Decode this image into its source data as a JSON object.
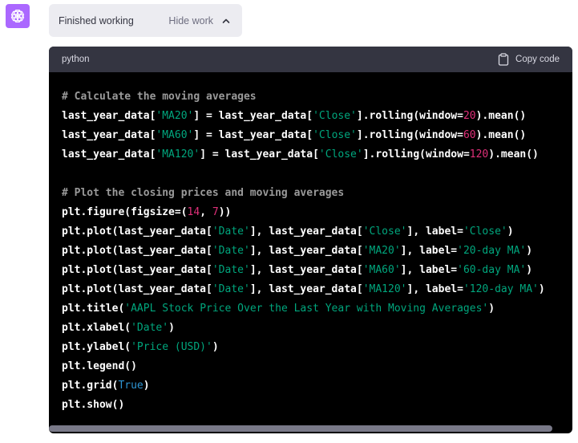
{
  "status": {
    "text": "Finished working",
    "toggle_label": "Hide work"
  },
  "code_block": {
    "language": "python",
    "copy_label": "Copy code",
    "tokens": {
      "c1": "# Calculate the moving averages",
      "l2a": "last_year_data[",
      "l2s1": "'MA20'",
      "l2b": "] = last_year_data[",
      "l2s2": "'Close'",
      "l2c": "].rolling(window=",
      "l2n": "20",
      "l2d": ").mean()",
      "l3a": "last_year_data[",
      "l3s1": "'MA60'",
      "l3b": "] = last_year_data[",
      "l3s2": "'Close'",
      "l3c": "].rolling(window=",
      "l3n": "60",
      "l3d": ").mean()",
      "l4a": "last_year_data[",
      "l4s1": "'MA120'",
      "l4b": "] = last_year_data[",
      "l4s2": "'Close'",
      "l4c": "].rolling(window=",
      "l4n": "120",
      "l4d": ").mean()",
      "c2": "# Plot the closing prices and moving averages",
      "l7a": "plt.figure(figsize=(",
      "l7n1": "14",
      "l7b": ", ",
      "l7n2": "7",
      "l7c": "))",
      "l8a": "plt.plot(last_year_data[",
      "l8s1": "'Date'",
      "l8b": "], last_year_data[",
      "l8s2": "'Close'",
      "l8c": "], label=",
      "l8s3": "'Close'",
      "l8d": ")",
      "l9a": "plt.plot(last_year_data[",
      "l9s1": "'Date'",
      "l9b": "], last_year_data[",
      "l9s2": "'MA20'",
      "l9c": "], label=",
      "l9s3": "'20-day MA'",
      "l9d": ")",
      "l10a": "plt.plot(last_year_data[",
      "l10s1": "'Date'",
      "l10b": "], last_year_data[",
      "l10s2": "'MA60'",
      "l10c": "], label=",
      "l10s3": "'60-day MA'",
      "l10d": ")",
      "l11a": "plt.plot(last_year_data[",
      "l11s1": "'Date'",
      "l11b": "], last_year_data[",
      "l11s2": "'MA120'",
      "l11c": "], label=",
      "l11s3": "'120-day MA'",
      "l11d": ")",
      "l12a": "plt.title(",
      "l12s": "'AAPL Stock Price Over the Last Year with Moving Averages'",
      "l12b": ")",
      "l13a": "plt.xlabel(",
      "l13s": "'Date'",
      "l13b": ")",
      "l14a": "plt.ylabel(",
      "l14s": "'Price (USD)'",
      "l14b": ")",
      "l15": "plt.legend()",
      "l16a": "plt.grid(",
      "l16k": "True",
      "l16b": ")",
      "l17": "plt.show()"
    }
  },
  "colors": {
    "avatar_bg": "#ab68ff",
    "code_bg": "#000000",
    "header_bg": "#343541",
    "string": "#00a67d",
    "number": "#df3079",
    "keyword": "#2e95d3",
    "comment": "#9a9a9a"
  },
  "icons": {
    "avatar": "openai-logo-icon",
    "toggle": "chevron-up-icon",
    "copy": "clipboard-icon"
  }
}
